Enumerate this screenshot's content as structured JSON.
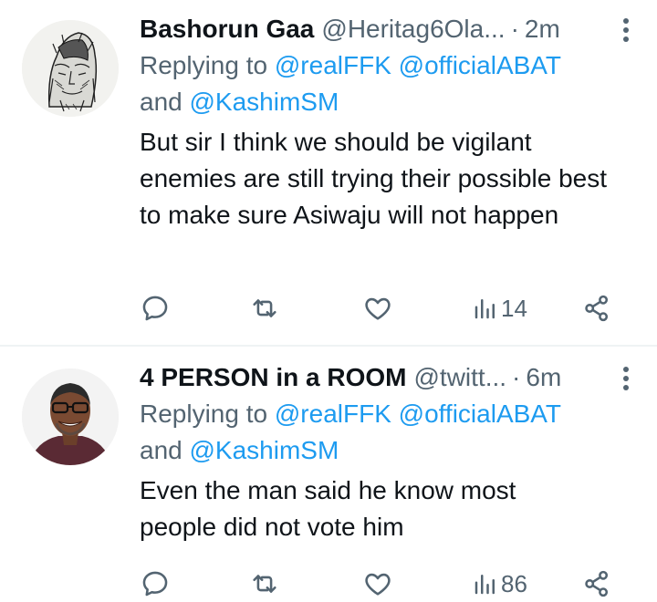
{
  "tweets": [
    {
      "name": "Bashorun Gaa",
      "handle": "@Heritag6Ola...",
      "dot": "·",
      "time": "2m",
      "replying_prefix": "Replying to ",
      "mention1": "@realFFK",
      "mention2": "@officialABAT",
      "replying_and": "and ",
      "mention3": "@KashimSM",
      "text": "But sir I think we should be vigilant enemies are still trying their possible best to make sure Asiwaju will not happen",
      "views": "14",
      "avatar_icon": "sketch-portrait-avatar"
    },
    {
      "name": "4 PERSON in a ROOM",
      "handle": "@twitt...",
      "dot": "·",
      "time": "6m",
      "replying_prefix": "Replying to ",
      "mention1": "@realFFK",
      "mention2": "@officialABAT",
      "replying_and": "and ",
      "mention3": "@KashimSM",
      "text": "Even the man said he know most people did not vote him",
      "views": "86",
      "avatar_icon": "photo-portrait-avatar"
    }
  ],
  "colors": {
    "mention": "#1d9bf0",
    "secondary": "#536471",
    "text": "#0f1419",
    "divider": "#eff3f4"
  }
}
